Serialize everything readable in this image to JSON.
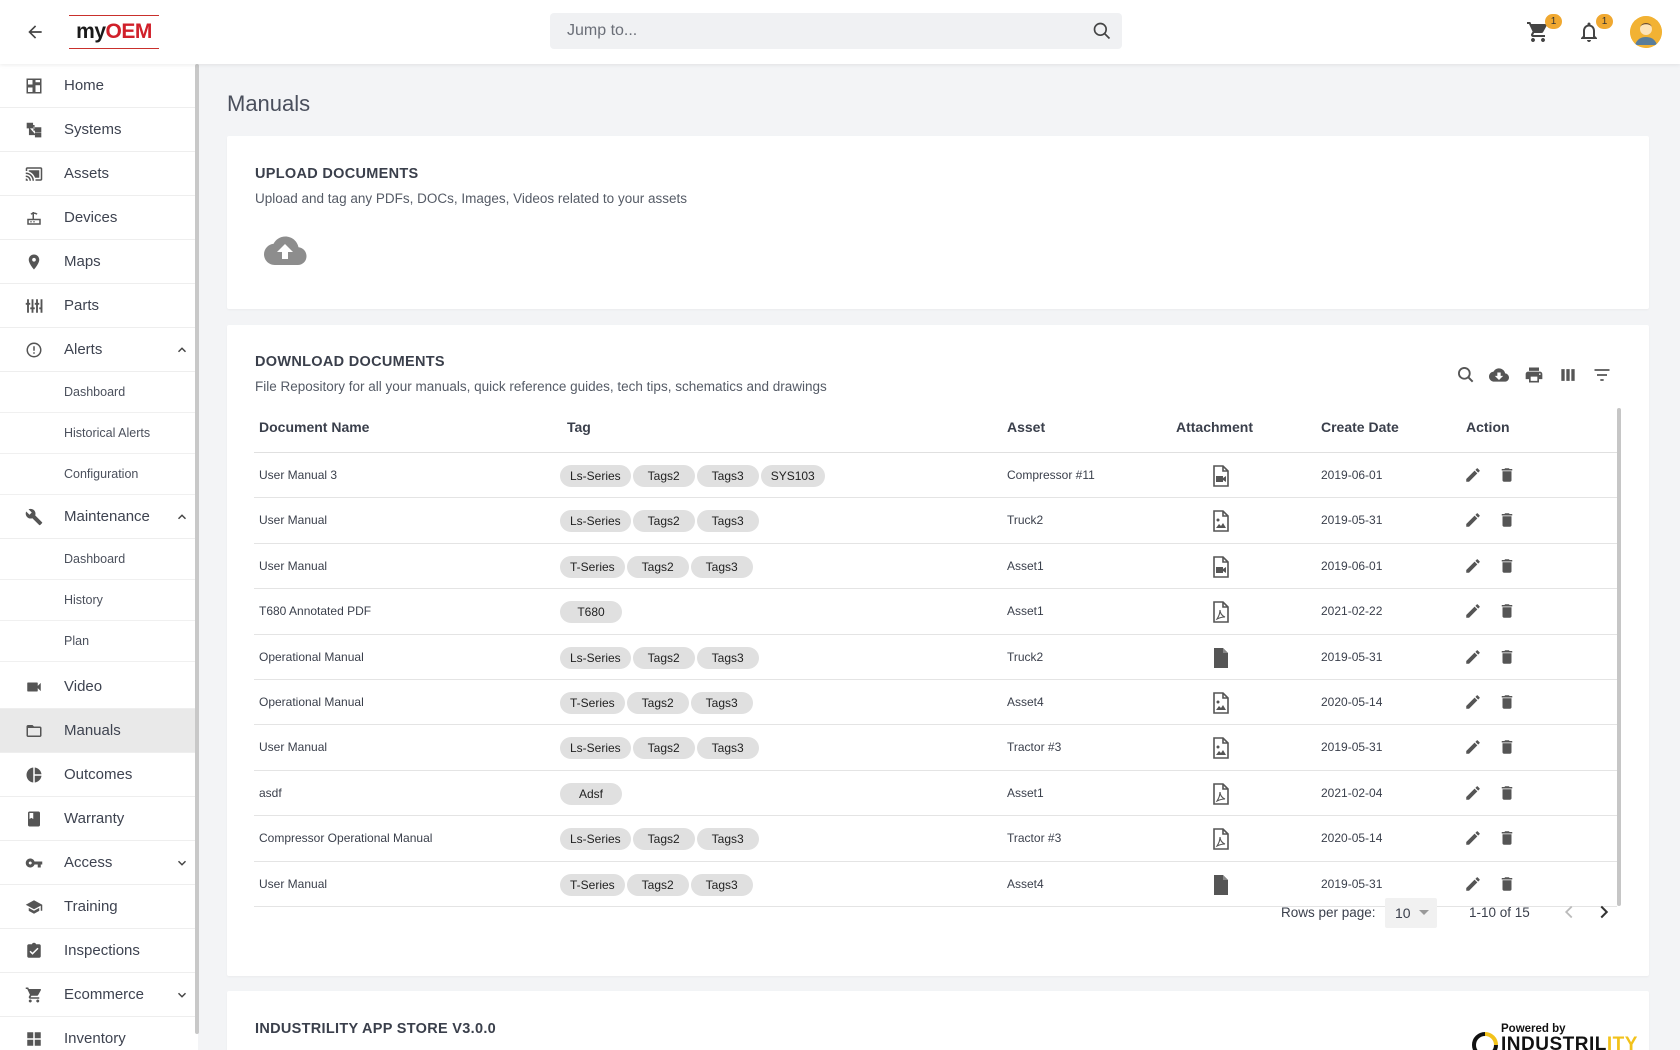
{
  "topbar": {
    "logo_my": "my",
    "logo_oem": "OEM",
    "search_placeholder": "Jump to...",
    "cart_badge": "1",
    "notifications_badge": "1"
  },
  "sidebar": {
    "items": [
      {
        "label": "Home"
      },
      {
        "label": "Systems"
      },
      {
        "label": "Assets"
      },
      {
        "label": "Devices"
      },
      {
        "label": "Maps"
      },
      {
        "label": "Parts"
      },
      {
        "label": "Alerts"
      },
      {
        "label": "Maintenance"
      },
      {
        "label": "Video"
      },
      {
        "label": "Manuals"
      },
      {
        "label": "Outcomes"
      },
      {
        "label": "Warranty"
      },
      {
        "label": "Access"
      },
      {
        "label": "Training"
      },
      {
        "label": "Inspections"
      },
      {
        "label": "Ecommerce"
      },
      {
        "label": "Inventory"
      }
    ],
    "alerts_sub": [
      "Dashboard",
      "Historical Alerts",
      "Configuration"
    ],
    "maintenance_sub": [
      "Dashboard",
      "History",
      "Plan"
    ]
  },
  "main": {
    "page_title": "Manuals",
    "upload": {
      "title": "UPLOAD DOCUMENTS",
      "subtitle": "Upload and tag any PDFs, DOCs, Images, Videos related to your assets"
    },
    "download": {
      "title": "DOWNLOAD DOCUMENTS",
      "subtitle": "File Repository for all your manuals, quick reference guides, tech tips, schematics and drawings"
    },
    "table": {
      "columns": [
        "Document Name",
        "Tag",
        "Asset",
        "Attachment",
        "Create Date",
        "Action"
      ],
      "rows": [
        {
          "name": "User Manual 3",
          "tags": [
            "Ls-Series",
            "Tags2",
            "Tags3",
            "SYS103"
          ],
          "asset": "Compressor #11",
          "attachment": "video-file-icon",
          "date": "2019-06-01"
        },
        {
          "name": "User Manual",
          "tags": [
            "Ls-Series",
            "Tags2",
            "Tags3"
          ],
          "asset": "Truck2",
          "attachment": "image-file-icon",
          "date": "2019-05-31"
        },
        {
          "name": "User Manual",
          "tags": [
            "T-Series",
            "Tags2",
            "Tags3"
          ],
          "asset": "Asset1",
          "attachment": "video-file-icon",
          "date": "2019-06-01"
        },
        {
          "name": "T680 Annotated PDF",
          "tags": [
            "T680"
          ],
          "asset": "Asset1",
          "attachment": "pdf-file-icon",
          "date": "2021-02-22"
        },
        {
          "name": "Operational Manual",
          "tags": [
            "Ls-Series",
            "Tags2",
            "Tags3"
          ],
          "asset": "Truck2",
          "attachment": "file-icon",
          "date": "2019-05-31"
        },
        {
          "name": "Operational Manual",
          "tags": [
            "T-Series",
            "Tags2",
            "Tags3"
          ],
          "asset": "Asset4",
          "attachment": "image-file-icon",
          "date": "2020-05-14"
        },
        {
          "name": "User Manual",
          "tags": [
            "Ls-Series",
            "Tags2",
            "Tags3"
          ],
          "asset": "Tractor #3",
          "attachment": "image-file-icon",
          "date": "2019-05-31"
        },
        {
          "name": "asdf",
          "tags": [
            "Adsf"
          ],
          "asset": "Asset1",
          "attachment": "pdf-file-icon",
          "date": "2021-02-04"
        },
        {
          "name": "Compressor Operational Manual",
          "tags": [
            "Ls-Series",
            "Tags2",
            "Tags3"
          ],
          "asset": "Tractor #3",
          "attachment": "pdf-file-icon",
          "date": "2020-05-14"
        },
        {
          "name": "User Manual",
          "tags": [
            "T-Series",
            "Tags2",
            "Tags3"
          ],
          "asset": "Asset4",
          "attachment": "file-icon",
          "date": "2019-05-31"
        }
      ]
    },
    "pagination": {
      "rows_per_page_label": "Rows per page:",
      "rows_per_page_value": "10",
      "range": "1-10 of 15"
    },
    "app_store": {
      "title": "INDUSTRILITY APP STORE V3.0.0",
      "powered_by": "Powered by",
      "brand_main": "INDUSTRIL",
      "brand_tail": "ITY"
    }
  },
  "colors": {
    "accent_badge": "#f0a830",
    "logo_red": "#d0202a",
    "active_nav_bg": "#e9e9e9",
    "chip_bg": "#e0e0e0"
  }
}
